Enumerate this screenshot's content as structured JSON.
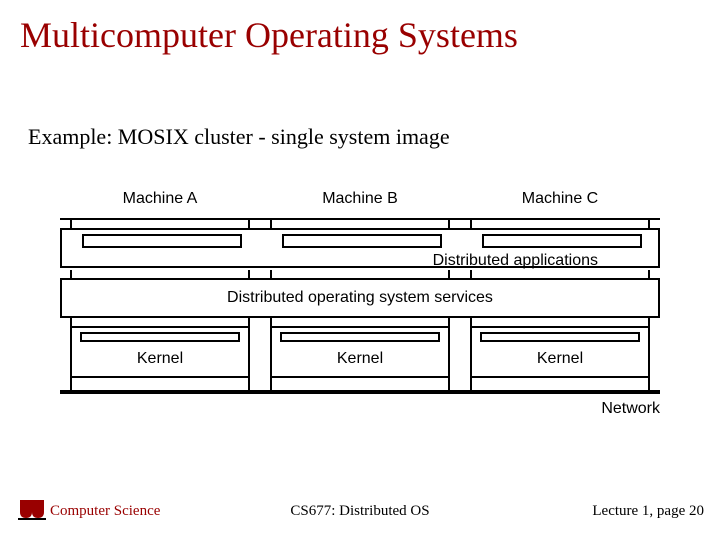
{
  "slide": {
    "title": "Multicomputer Operating Systems",
    "subtitle": "Example: MOSIX cluster - single system image"
  },
  "diagram": {
    "machines": [
      "Machine A",
      "Machine B",
      "Machine C"
    ],
    "apps_label": "Distributed applications",
    "dos_label": "Distributed operating system services",
    "kernel_label": "Kernel",
    "network_label": "Network"
  },
  "footer": {
    "dept": "Computer Science",
    "course": "CS677: Distributed OS",
    "pagenum": "Lecture 1, page 20"
  }
}
